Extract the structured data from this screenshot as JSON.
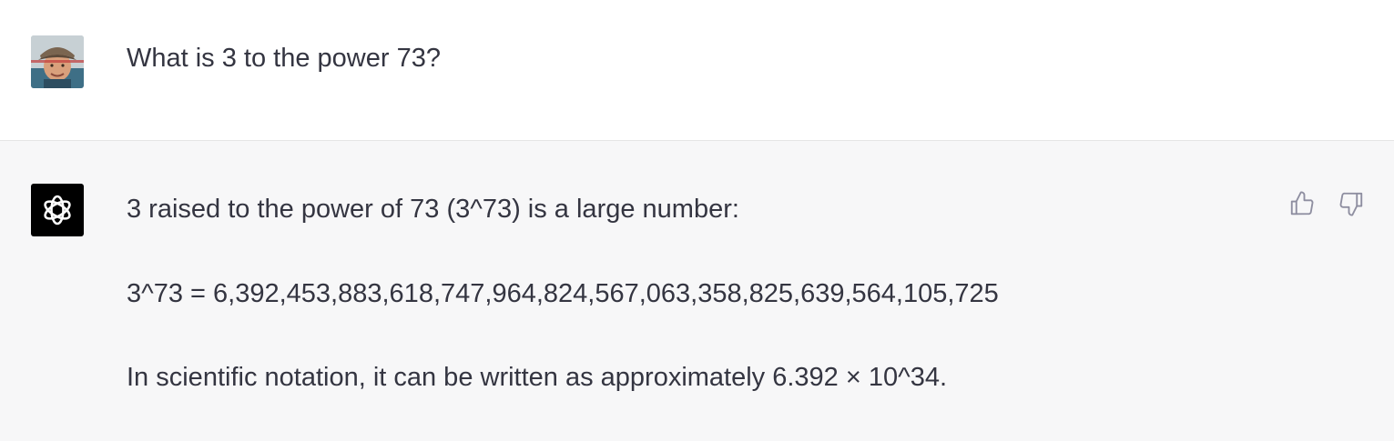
{
  "conversation": {
    "user_message": {
      "text": "What is 3 to the power 73?",
      "avatar_icon": "user-photo-avatar"
    },
    "assistant_message": {
      "avatar_icon": "openai-logo-icon",
      "paragraphs": [
        "3 raised to the power of 73 (3^73) is a large number:",
        "3^73 = 6,392,453,883,618,747,964,824,567,063,358,825,639,564,105,725",
        "In scientific notation, it can be written as approximately 6.392 × 10^34."
      ],
      "feedback": {
        "thumbs_up_icon": "thumbs-up-icon",
        "thumbs_down_icon": "thumbs-down-icon"
      }
    }
  },
  "colors": {
    "user_bg": "#ffffff",
    "assistant_bg": "#f7f7f8",
    "text": "#343541",
    "icon_gray": "#8e8ea0"
  }
}
